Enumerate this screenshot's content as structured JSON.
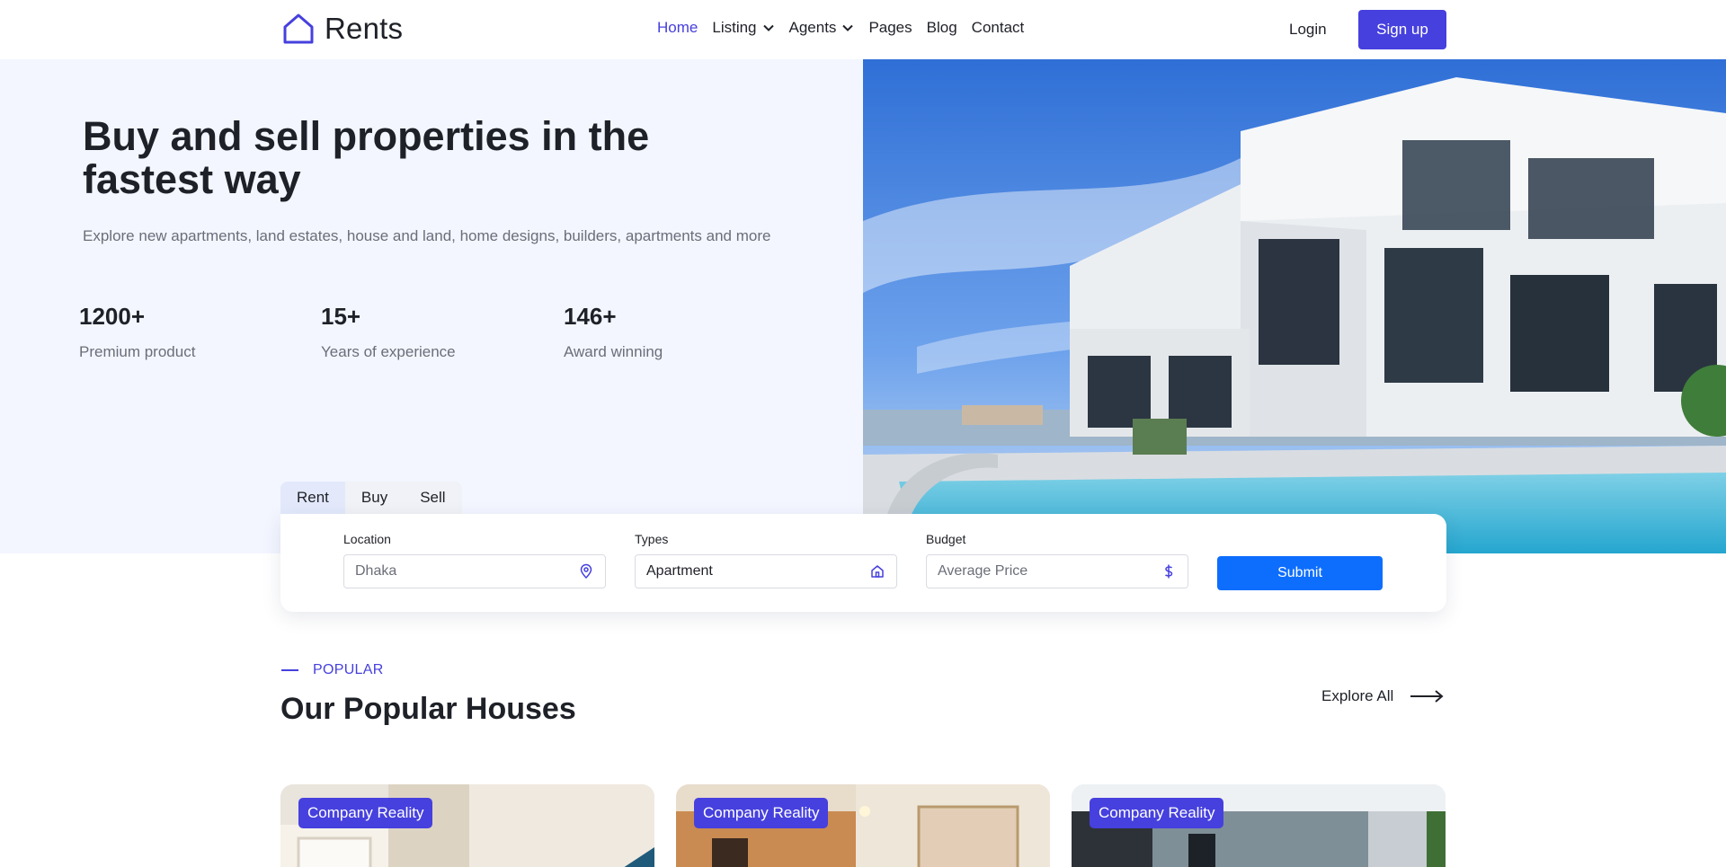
{
  "header": {
    "brand": "Rents",
    "nav": [
      {
        "label": "Home",
        "active": true,
        "dropdown": false
      },
      {
        "label": "Listing",
        "active": false,
        "dropdown": true
      },
      {
        "label": "Agents",
        "active": false,
        "dropdown": true
      },
      {
        "label": "Pages",
        "active": false,
        "dropdown": false
      },
      {
        "label": "Blog",
        "active": false,
        "dropdown": false
      },
      {
        "label": "Contact",
        "active": false,
        "dropdown": false
      }
    ],
    "login_label": "Login",
    "signup_label": "Sign up"
  },
  "hero": {
    "title": "Buy and sell properties in the fastest way",
    "subtitle": "Explore new apartments, land estates, house and land, home designs, builders, apartments and more",
    "stats": [
      {
        "value": "1200+",
        "label": "Premium product"
      },
      {
        "value": "15+",
        "label": "Years of experience"
      },
      {
        "value": "146+",
        "label": "Award winning"
      }
    ]
  },
  "search": {
    "tabs": [
      "Rent",
      "Buy",
      "Sell"
    ],
    "active_tab": "Rent",
    "location": {
      "label": "Location",
      "placeholder": "Dhaka"
    },
    "types": {
      "label": "Types",
      "value": "Apartment"
    },
    "budget": {
      "label": "Budget",
      "placeholder": "Average Price"
    },
    "submit_label": "Submit"
  },
  "popular": {
    "eyebrow": "POPULAR",
    "title": "Our Popular Houses",
    "explore_label": "Explore All",
    "cards": [
      {
        "badge": "Company Reality"
      },
      {
        "badge": "Company Reality"
      },
      {
        "badge": "Company Reality"
      }
    ]
  },
  "colors": {
    "accent": "#4640de",
    "submit": "#0d6efd",
    "hero_bg": "#f3f6ff",
    "text": "#1f2128",
    "muted": "#6b6e78"
  }
}
